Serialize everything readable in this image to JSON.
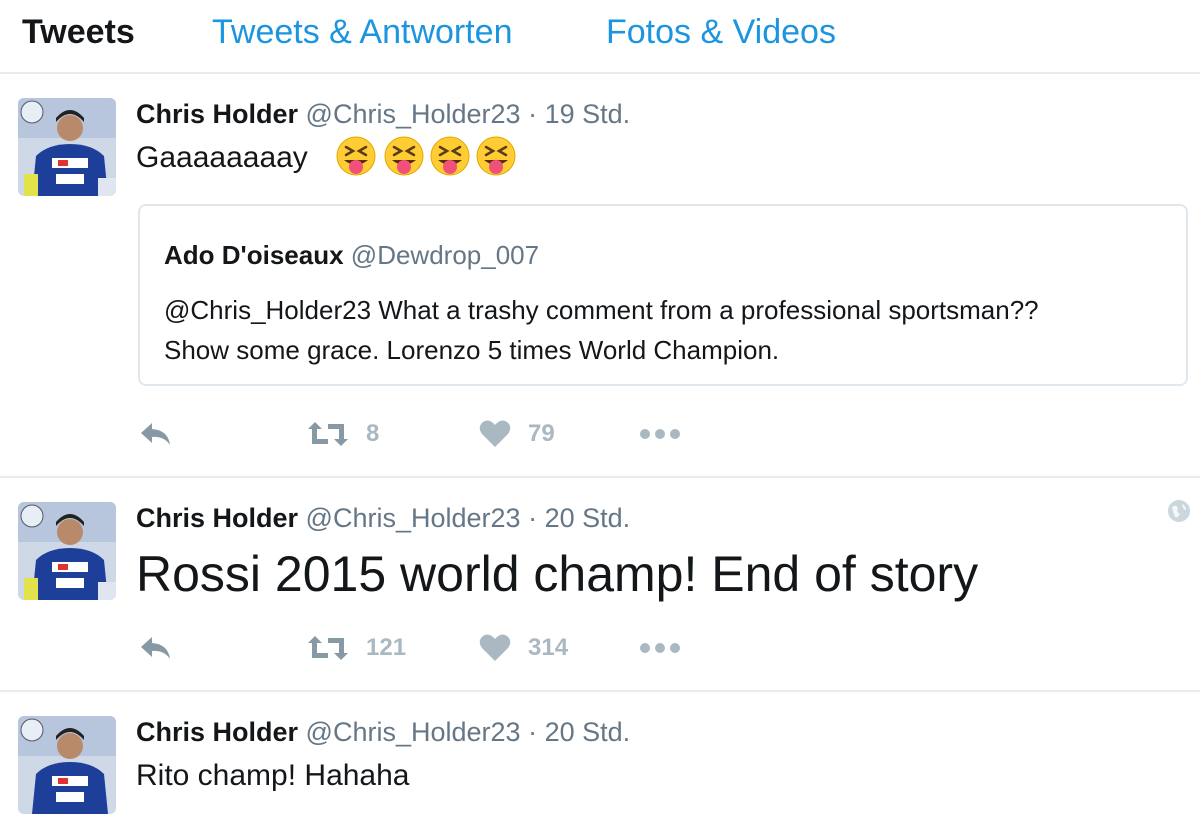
{
  "tabs": [
    {
      "label": "Tweets"
    },
    {
      "label": "Tweets & Antworten"
    },
    {
      "label": "Fotos & Videos"
    }
  ],
  "tweets": [
    {
      "name": "Chris Holder",
      "handle": "@Chris_Holder23",
      "separator": "·",
      "time": "19 Std.",
      "text": "Gaaaaaaaay",
      "emoji": "squinting-face-with-tongue",
      "emoji_count": 4,
      "quote": {
        "name": "Ado D'oiseaux",
        "handle": "@Dewdrop_007",
        "line1": "@Chris_Holder23  What a trashy comment from a professional sportsman??",
        "line2": "Show some grace. Lorenzo 5 times World Champion."
      },
      "retweets": "8",
      "likes": "79"
    },
    {
      "name": "Chris Holder",
      "handle": "@Chris_Holder23",
      "separator": "·",
      "time": "20 Std.",
      "text": "Rossi 2015 world champ! End of story",
      "retweets": "121",
      "likes": "314"
    },
    {
      "name": "Chris Holder",
      "handle": "@Chris_Holder23",
      "separator": "·",
      "time": "20 Std.",
      "text": "Rito champ! Hahaha"
    }
  ],
  "colors": {
    "link": "#1b95e0",
    "muted": "#657786",
    "action_icon": "#8899a6",
    "border": "#e6ecf0",
    "avatar_suit": "#1d3f9a"
  },
  "icons": [
    "reply-icon",
    "retweet-icon",
    "heart-icon",
    "more-icon",
    "globe-icon"
  ]
}
